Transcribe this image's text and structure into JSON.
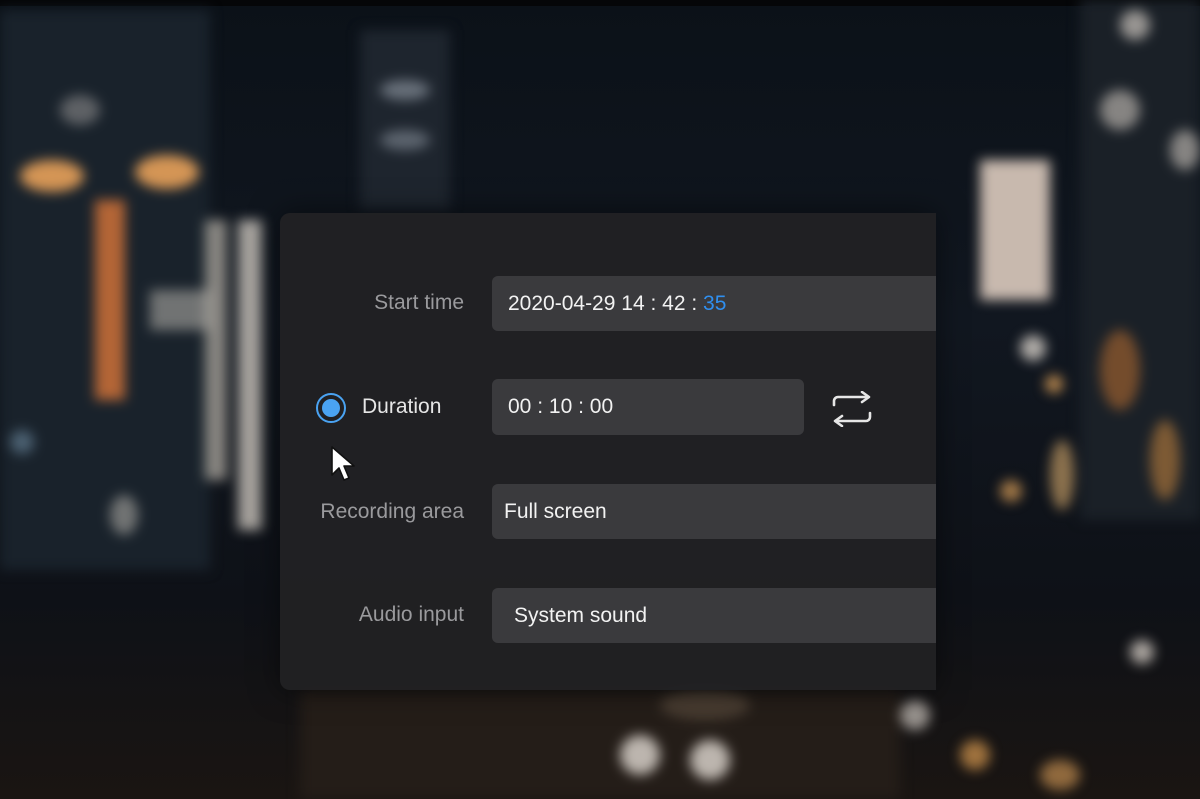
{
  "dialog": {
    "start_time": {
      "label": "Start time",
      "date": "2020-04-29",
      "hour": "14",
      "minute": "42",
      "second": "35",
      "separator": ":"
    },
    "duration": {
      "label": "Duration",
      "selected": true,
      "hours": "00",
      "minutes": "10",
      "seconds": "00",
      "separator": ":"
    },
    "recording_area": {
      "label": "Recording area",
      "value": "Full screen"
    },
    "audio_input": {
      "label": "Audio input",
      "value": "System sound"
    }
  },
  "colors": {
    "accent": "#4aa3f2",
    "panel_bg": "#212123",
    "field_bg": "#3a3a3d"
  },
  "icons": {
    "swap": "swap-arrows-icon",
    "cursor": "mouse-cursor-icon"
  }
}
